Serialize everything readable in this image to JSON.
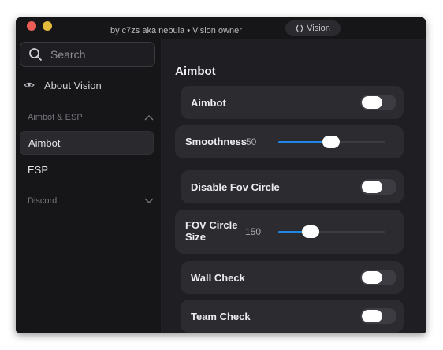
{
  "window": {
    "subtitle": "by c7zs aka nebula • Vision owner",
    "top_button_label": "Vision"
  },
  "sidebar": {
    "search_placeholder": "Search",
    "about_label": "About Vision",
    "sections": [
      {
        "title": "Aimbot & ESP",
        "items": [
          {
            "label": "Aimbot",
            "active": true
          },
          {
            "label": "ESP",
            "active": false
          }
        ]
      },
      {
        "title": "Discord",
        "items": []
      }
    ]
  },
  "main": {
    "title": "Aimbot",
    "settings": [
      {
        "type": "toggle",
        "label": "Aimbot",
        "enabled": false
      },
      {
        "type": "slider",
        "label": "Smoothness",
        "value": "50",
        "fill": 0.49
      },
      {
        "type": "toggle",
        "label": "Disable Fov Circle",
        "enabled": false
      },
      {
        "type": "slider",
        "label_lines": [
          "FOV Circle",
          "Size"
        ],
        "value": "150",
        "fill": 0.3
      },
      {
        "type": "toggle",
        "label": "Wall Check",
        "enabled": false
      },
      {
        "type": "toggle",
        "label": "Team Check",
        "enabled": false
      }
    ]
  },
  "colors": {
    "accent": "#1f86e8",
    "window_bg": "#1b1b1f",
    "card_bg": "#2b2b30"
  },
  "icons": {
    "search": "search-icon",
    "about": "eye-icon",
    "section_expanded": "chevron-up-icon",
    "section_collapsed": "chevron-down-icon"
  }
}
